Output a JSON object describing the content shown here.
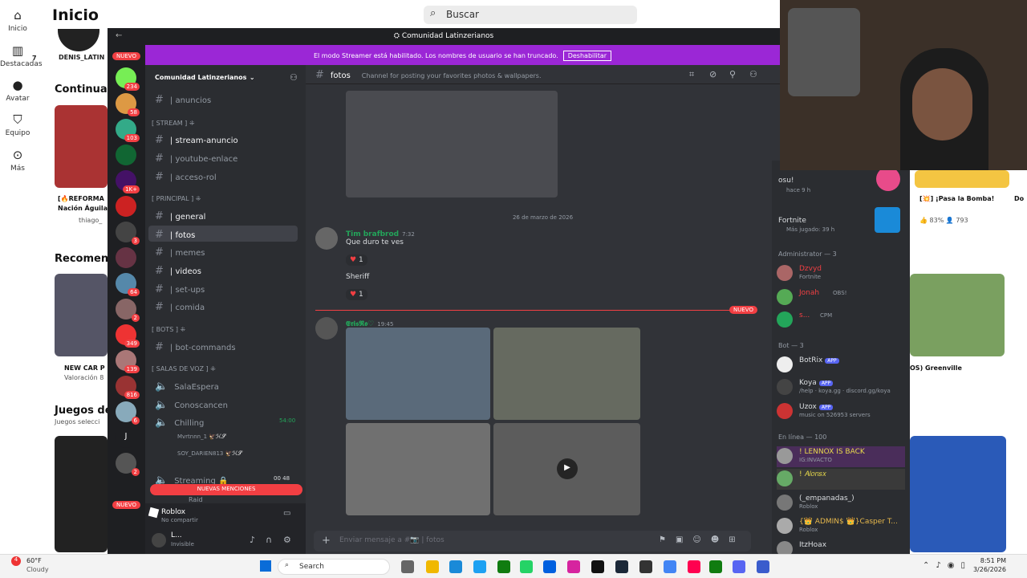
{
  "roblox": {
    "title": "Inicio",
    "search_placeholder": "Buscar",
    "nav": [
      {
        "label": "Inicio",
        "icon": "home-icon"
      },
      {
        "label": "Destacadas",
        "icon": "charts-icon"
      },
      {
        "label": "Avatar",
        "icon": "avatar-icon"
      },
      {
        "label": "Equipo",
        "icon": "inventory-icon"
      },
      {
        "label": "Más",
        "icon": "more-icon"
      }
    ],
    "friend_name": "DENIS_LATIN",
    "friend_suffix": "7",
    "section_continue": "Continuar",
    "section_recommended": "Recomenc",
    "section_games": "Juegos de",
    "section_games_sub": "Juegos selecci",
    "game_reformas": "[🔥REFORMA",
    "game_reformas_2": "Nación Águila",
    "game_reformas_user": "thiago_",
    "game_newcar": "NEW CAR P",
    "game_newcar_rating": "Valoración 8",
    "game_bomba": "[💥] ¡Pasa la Bomba!",
    "game_bomba_rating": "83%",
    "game_bomba_players": "793",
    "game_do": "Do",
    "game_greenville": "OS) Greenville"
  },
  "discord": {
    "window_title": "Comunidad Latinzerianos",
    "streamer_banner": "El modo Streamer está habilitado. Los nombres de usuario se han truncado.",
    "streamer_button": "Deshabilitar",
    "server_name": "Comunidad Latinzerianos",
    "nuevo": "NUEVO",
    "nuevas_menciones": "NUEVAS MENCIONES",
    "guild_badges": [
      "234",
      "58",
      "103",
      "1K+",
      "3",
      "64",
      "2",
      "349",
      "139",
      "816",
      "6",
      "J",
      "2"
    ],
    "channels": [
      {
        "name": "| anuncios",
        "icon": "megaphone-icon"
      },
      {
        "cat": "[ STREAM ] ⁜"
      },
      {
        "name": "| stream-anuncio",
        "icon": "red-dot-icon"
      },
      {
        "name": "| youtube-enlace",
        "icon": "youtube-icon"
      },
      {
        "name": "| acceso-rol",
        "icon": "lock-icon"
      },
      {
        "cat": "[ PRINCIPAL ] ⁜"
      },
      {
        "name": "| general",
        "icon": "people-icon"
      },
      {
        "name": "| fotos",
        "icon": "photo-icon"
      },
      {
        "name": "| memes",
        "icon": "emoji-icon"
      },
      {
        "name": "| videos",
        "icon": "camera-icon"
      },
      {
        "name": "| set-ups",
        "icon": "setup-icon"
      },
      {
        "name": "| comida",
        "icon": "food-icon"
      },
      {
        "cat": "[ BOTS ] ⁜"
      },
      {
        "name": "| bot-commands",
        "icon": "bot-icon"
      },
      {
        "cat": "[ SALAS DE VOZ ] ⁜"
      },
      {
        "name": "SalaEspera",
        "icon": "speaker-icon"
      },
      {
        "name": "Conoscancen",
        "icon": "speaker-icon"
      },
      {
        "name": "Chilling",
        "icon": "speaker-icon"
      }
    ],
    "voice_users": [
      "Mvrtnnn_1",
      "SOY_DARIEN813"
    ],
    "voice_tag": "🦅ℋ𝒮",
    "chilling_time": "54:00",
    "streaming_channel": "Streaming 🔒",
    "streaming_counts": "00  48",
    "raid_channel": "Raid",
    "activity_app": "Roblox",
    "activity_status": "No compartir",
    "user_name": "L...",
    "user_status": "Invisible",
    "channel_header": "fotos",
    "channel_topic": "Channel for posting your favorites photos & wallpapers.",
    "date_divider": "26 de marzo de 2026",
    "msg1_author": "Tim brafbrod",
    "msg1_time": "7:32",
    "msg1_text": "Que duro te ves",
    "msg1_react": "1",
    "msg2_text": "Sheriff",
    "msg2_react": "1",
    "new_label": "NUEVO",
    "msg3_author": "𝕰𝖗𝖎𝖘𝕽𝖔♡",
    "msg3_time": "19:45",
    "composer_placeholder": "Enviar mensaje a #📷 | fotos",
    "members": {
      "top1_name": "osu!",
      "top1_status": "hace 9 h",
      "top2_name": "Fortnite",
      "top2_status": "Más jugado: 39 h",
      "admin_header": "Administrator — 3",
      "admins": [
        {
          "name": "Dzvyd",
          "status": "Fortnite"
        },
        {
          "name": "Jonah",
          "status": "OBS!"
        },
        {
          "name": "s...",
          "status": "CPM"
        }
      ],
      "bot_header": "Bot — 3",
      "bots": [
        {
          "name": "BotRix",
          "status": ""
        },
        {
          "name": "Koya",
          "status": "/help · koya.gg · discord.gg/koya"
        },
        {
          "name": "Uzox",
          "status": "music on 526953 servers"
        }
      ],
      "app_tag": "APP",
      "online_header": "En línea — 100",
      "online": [
        {
          "name": "! LENNOX IS BACK",
          "status": "IG:INVACTO"
        },
        {
          "name": "! 𝐴𝑙𝑜𝑛𝑠𝑥",
          "status": ""
        },
        {
          "name": "(_empanadas_)",
          "status": "Roblox"
        },
        {
          "name": "{👑 ADMIN$ 👑}Casper T...",
          "status": "Roblox"
        },
        {
          "name": "ItzHoax",
          "status": ""
        }
      ]
    }
  },
  "taskbar": {
    "weather_temp": "60°F",
    "weather_desc": "Cloudy",
    "search_label": "Search",
    "time": "8:51 PM",
    "date": "3/26/2026",
    "badge": "4"
  }
}
